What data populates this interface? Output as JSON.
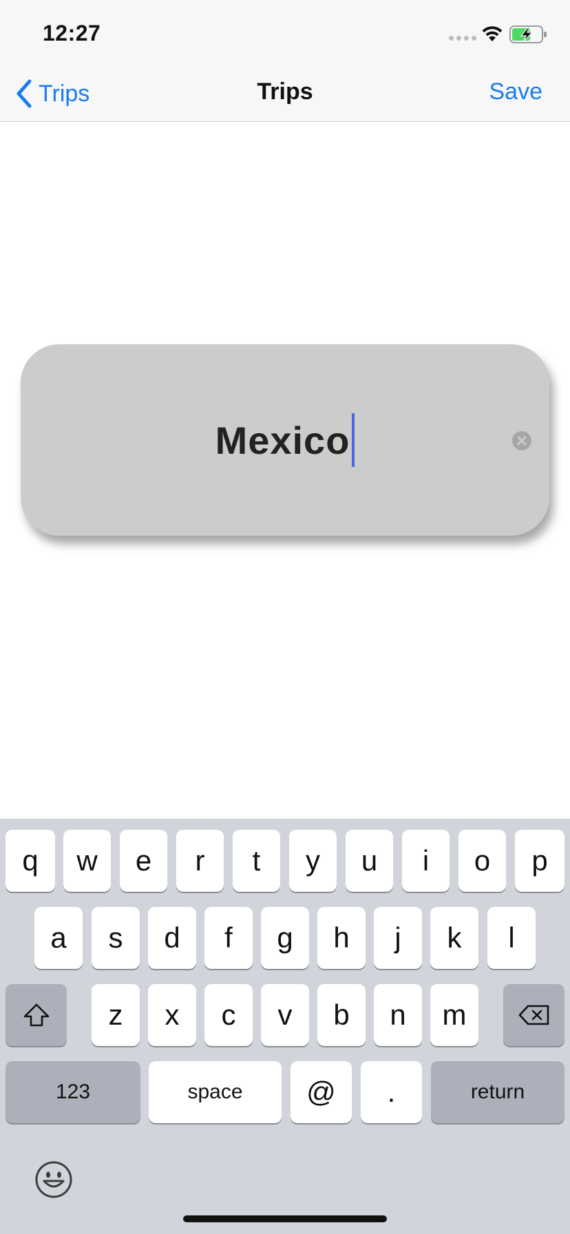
{
  "status_bar": {
    "time": "12:27",
    "icons": [
      "cellular-signal-icon",
      "wifi-icon",
      "battery-charging-icon"
    ],
    "battery_color": "#4cd964"
  },
  "nav": {
    "back_label": "Trips",
    "title": "Trips",
    "save_label": "Save",
    "accent_color": "#1a7cf0"
  },
  "trip_name_field": {
    "value": "Mexico",
    "clear_icon": "clear-circle-x-icon"
  },
  "keyboard": {
    "row1": [
      "q",
      "w",
      "e",
      "r",
      "t",
      "y",
      "u",
      "i",
      "o",
      "p"
    ],
    "row2": [
      "a",
      "s",
      "d",
      "f",
      "g",
      "h",
      "j",
      "k",
      "l"
    ],
    "row3": [
      "z",
      "x",
      "c",
      "v",
      "b",
      "n",
      "m"
    ],
    "shift_icon": "shift-arrow-icon",
    "delete_icon": "backspace-icon",
    "numbers_label": "123",
    "space_label": "space",
    "at_label": "@",
    "period_label": ".",
    "return_label": "return",
    "emoji_icon": "emoji-face-icon"
  }
}
